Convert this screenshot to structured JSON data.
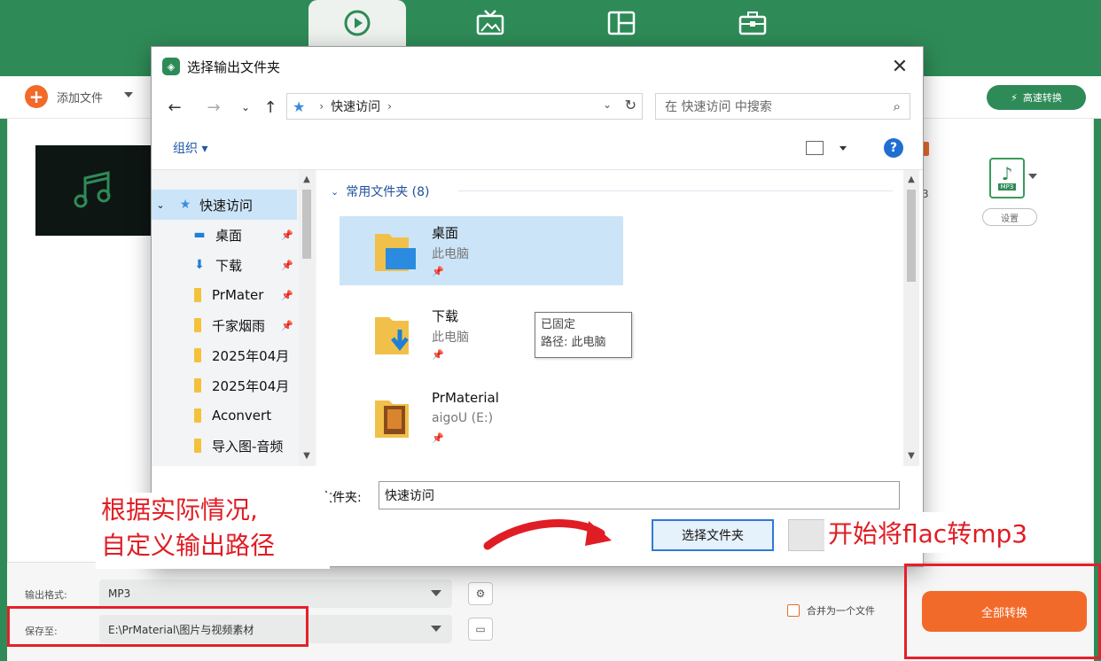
{
  "app": {
    "tabs": [
      {
        "icon": "convert-icon",
        "active": true
      },
      {
        "icon": "tv-icon",
        "active": false
      },
      {
        "icon": "layout-icon",
        "active": false
      },
      {
        "icon": "toolbox-icon",
        "active": false
      }
    ],
    "toolbar": {
      "add_file": "添加文件",
      "speed": "高速转换"
    },
    "item": {
      "format": "MP3",
      "settings": "设置",
      "side_number": "3"
    },
    "footer": {
      "output_format_label": "输出格式:",
      "output_format_value": "MP3",
      "save_to_label": "保存至:",
      "save_to_value": "E:\\PrMaterial\\图片与视频素材",
      "merge_label": "合并为一个文件",
      "convert_all": "全部转换"
    },
    "colors": {
      "brand_green": "#2e8b57",
      "accent_orange": "#f26a2a",
      "annotation_red": "#e01d24"
    }
  },
  "dialog": {
    "title": "选择输出文件夹",
    "close": "✕",
    "address": {
      "location": "快速访问"
    },
    "search_placeholder": "在 快速访问 中搜索",
    "organize": "组织 ▾",
    "help": "?",
    "nav": {
      "root": "快速访问",
      "items": [
        {
          "label": "桌面",
          "icon": "desktop-icon",
          "pinned": true
        },
        {
          "label": "下载",
          "icon": "download-icon",
          "pinned": true
        },
        {
          "label": "PrMater",
          "icon": "folder-icon",
          "pinned": true
        },
        {
          "label": "千家烟雨",
          "icon": "folder-icon",
          "pinned": true
        },
        {
          "label": "2025年04月",
          "icon": "folder-icon",
          "pinned": false
        },
        {
          "label": "2025年04月",
          "icon": "folder-icon",
          "pinned": false
        },
        {
          "label": "Aconvert",
          "icon": "folder-icon",
          "pinned": false
        },
        {
          "label": "导入图-音频",
          "icon": "folder-icon",
          "pinned": false
        }
      ]
    },
    "group_header": "常用文件夹 (8)",
    "tiles": [
      {
        "name": "桌面",
        "sub": "此电脑",
        "selected": true
      },
      {
        "name": "下载",
        "sub": "此电脑",
        "selected": false
      },
      {
        "name": "PrMaterial",
        "sub": "aigoU (E:)",
        "selected": false
      }
    ],
    "tooltip": {
      "line1": "已固定",
      "line2": "路径: 此电脑"
    },
    "folder_label": "文件夹:",
    "folder_value": "快速访问",
    "select_folder": "选择文件夹"
  },
  "annotations": {
    "left_line1": "根据实际情况,",
    "left_line2": "自定义输出路径",
    "right": "开始将flac转mp3"
  }
}
